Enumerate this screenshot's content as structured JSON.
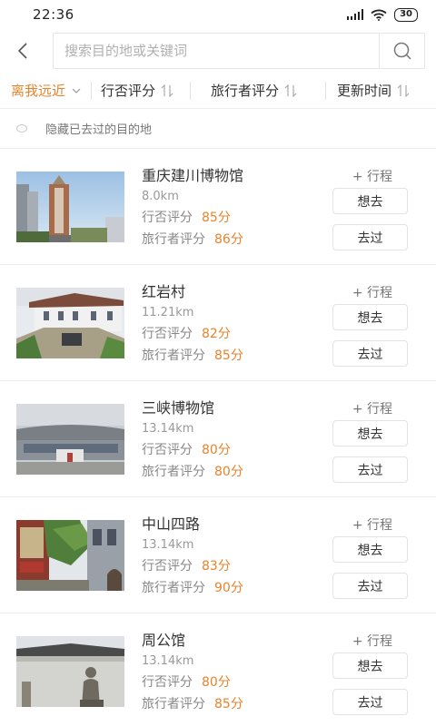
{
  "status_bar": {
    "time": "22:36",
    "battery": "30"
  },
  "search": {
    "placeholder": "搜索目的地或关键词"
  },
  "filters": [
    {
      "label": "离我远近"
    },
    {
      "label": "行否评分"
    },
    {
      "label": "旅行者评分"
    },
    {
      "label": "更新时间"
    }
  ],
  "hide_visited": {
    "label": "隐藏已去过的目的地"
  },
  "item_labels": {
    "plan": "+ 行程",
    "want": "想去",
    "been": "去过",
    "xingfou_score_label": "行否评分",
    "traveler_score_label": "旅行者评分"
  },
  "places": [
    {
      "name": "重庆建川博物馆",
      "distance": "8.0km",
      "xingfou_score": "85分",
      "traveler_score": "86分"
    },
    {
      "name": "红岩村",
      "distance": "11.21km",
      "xingfou_score": "82分",
      "traveler_score": "85分"
    },
    {
      "name": "三峡博物馆",
      "distance": "13.14km",
      "xingfou_score": "80分",
      "traveler_score": "80分"
    },
    {
      "name": "中山四路",
      "distance": "13.14km",
      "xingfou_score": "83分",
      "traveler_score": "90分"
    },
    {
      "name": "周公馆",
      "distance": "13.14km",
      "xingfou_score": "80分",
      "traveler_score": "85分"
    }
  ],
  "colors": {
    "accent": "#e8832a",
    "divider": "#eeeeee",
    "muted_text": "#999999"
  }
}
